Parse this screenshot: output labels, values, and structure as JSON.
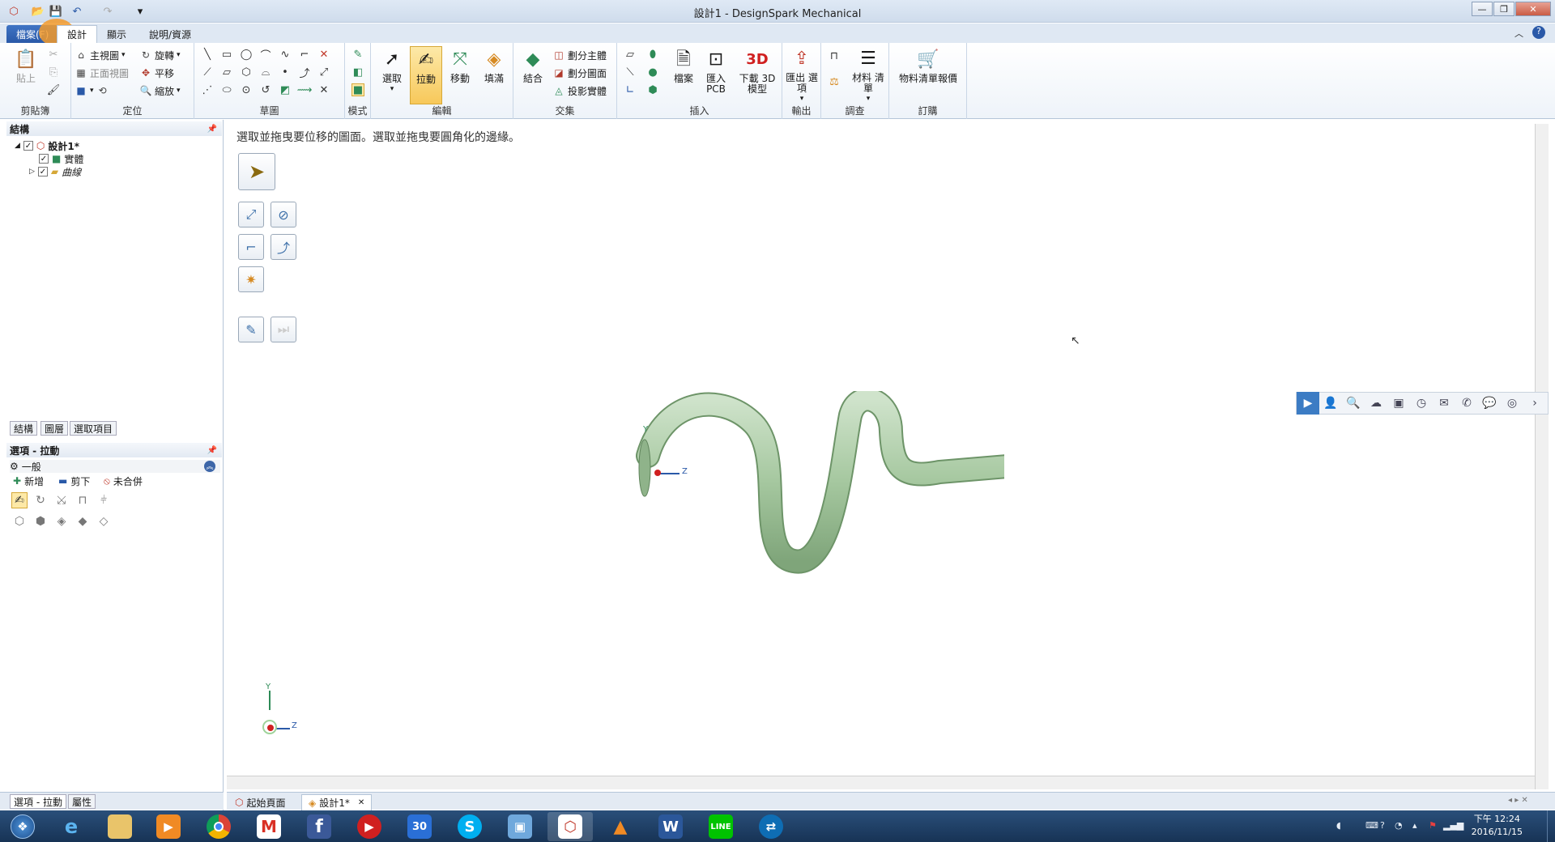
{
  "window": {
    "title": "設計1 - DesignSpark Mechanical"
  },
  "ribbon_tabs": [
    {
      "label": "檔案(F)"
    },
    {
      "label": "設計"
    },
    {
      "label": "顯示"
    },
    {
      "label": "說明/資源"
    }
  ],
  "groups": {
    "clipboard": {
      "label": "剪貼簿",
      "paste": "貼上"
    },
    "orient": {
      "label": "定位",
      "home": "主視圖",
      "front": "正面視圖",
      "rotate": "旋轉",
      "pan": "平移",
      "zoom": "縮放"
    },
    "sketch": {
      "label": "草圖"
    },
    "mode": {
      "label": "模式"
    },
    "edit": {
      "label": "編輯",
      "select": "選取",
      "pull": "拉動",
      "move": "移動",
      "fill": "填滿"
    },
    "intersect": {
      "label": "交集",
      "combine": "結合",
      "split_body": "劃分主體",
      "split_face": "劃分圖面",
      "project": "投影實體"
    },
    "insert": {
      "label": "插入",
      "file": "檔案",
      "import_pcb": "匯入 PCB",
      "download_3d": "下載 3D 模型"
    },
    "output": {
      "label": "輸出",
      "export": "匯出 選項"
    },
    "investigate": {
      "label": "調查",
      "bom": "材料 清單"
    },
    "order": {
      "label": "訂購",
      "bom_quote": "物料清單報價"
    }
  },
  "structure": {
    "header": "結構",
    "root": "設計1*",
    "children": [
      {
        "label": "實體"
      },
      {
        "label": "曲線"
      }
    ],
    "tabs": [
      "結構",
      "圖層",
      "選取項目"
    ]
  },
  "options": {
    "header": "選項 - 拉動",
    "section": "一般",
    "add": "新增",
    "cut": "剪下",
    "no_merge": "未合併"
  },
  "left_bottom_tabs": [
    "選項 - 拉動",
    "屬性"
  ],
  "viewport": {
    "hint": "選取並拖曳要位移的圖面。選取並拖曳要圓角化的邊緣。",
    "model_color": "#a6c8a0",
    "axis": {
      "y": "Y",
      "z": "Z"
    }
  },
  "doc_tabs": [
    "起始頁面",
    "設計1*"
  ],
  "taskbar": {
    "apps": [
      "start",
      "ie",
      "explorer",
      "media",
      "chrome",
      "gmail",
      "facebook",
      "player",
      "calendar",
      "skype",
      "remote",
      "designspark",
      "vlc",
      "word",
      "line",
      "teamviewer"
    ],
    "calendar_day": "30",
    "clock_time": "下午 12:24",
    "clock_date": "2016/11/15"
  }
}
